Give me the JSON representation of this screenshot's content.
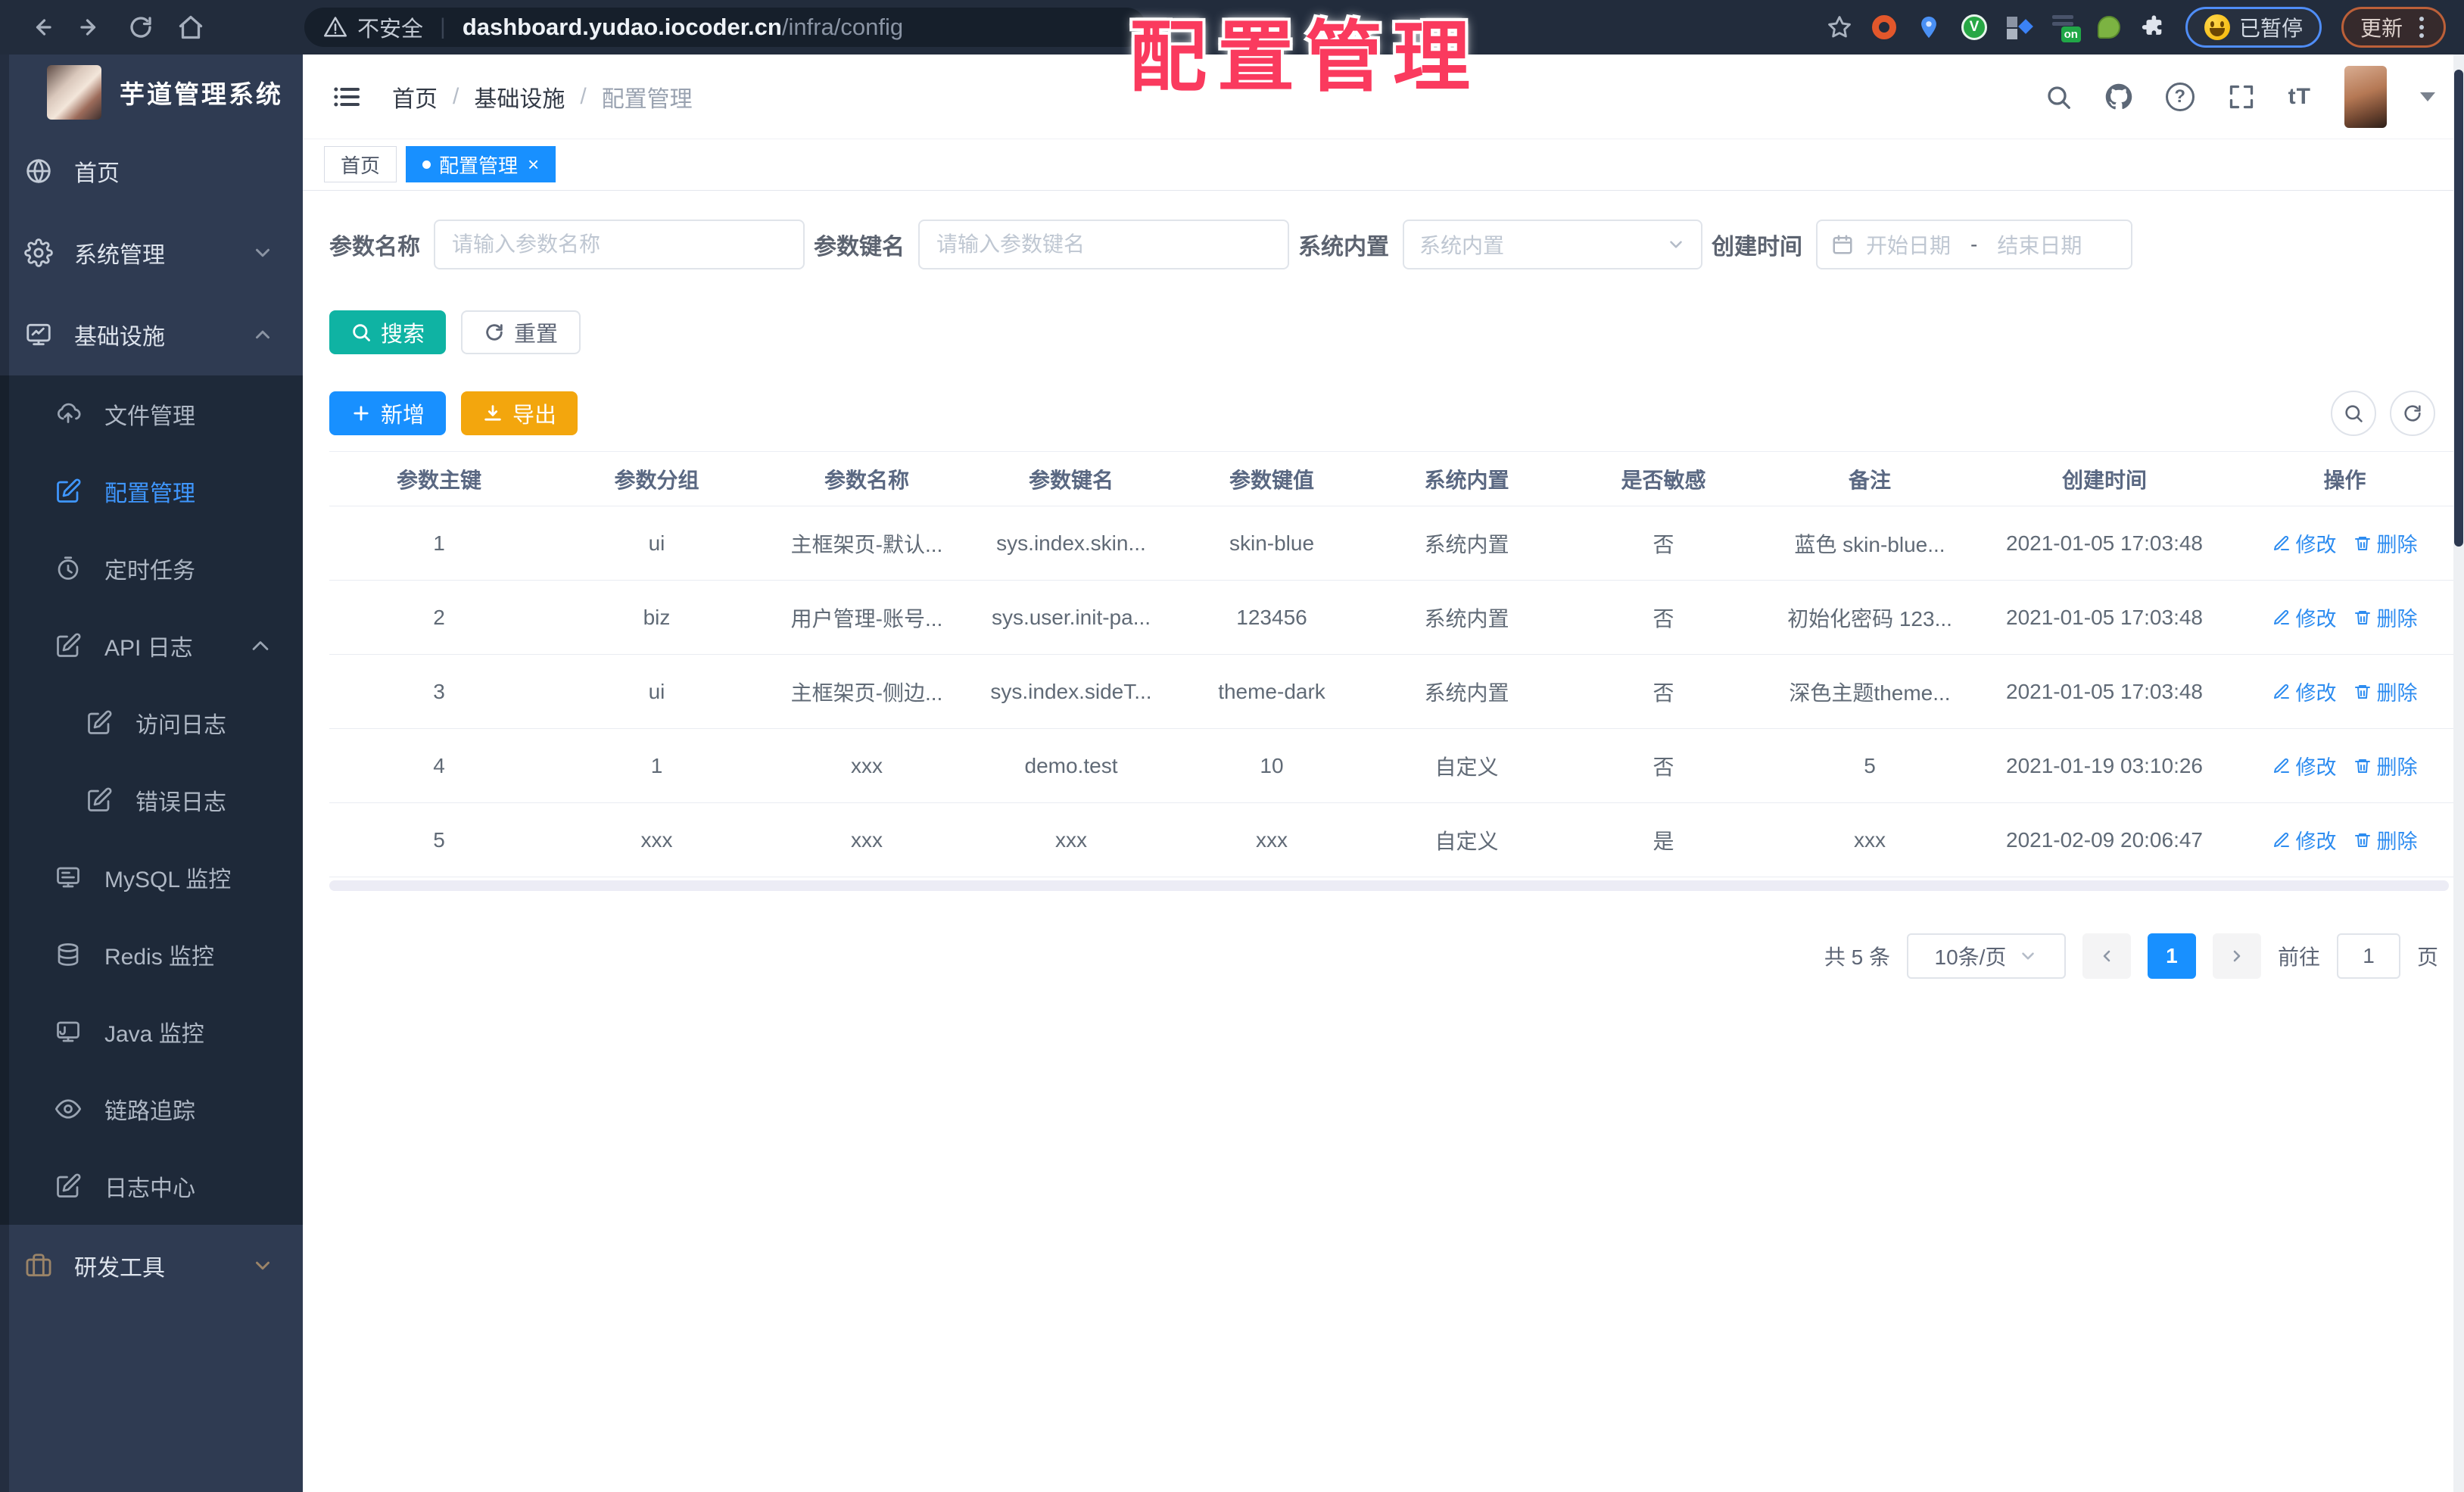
{
  "colors": {
    "accent_blue": "#1890ff",
    "search_teal": "#0fb3a3",
    "export_amber": "#f3a60d",
    "link_blue": "#2d8cf0",
    "sidebar_bg": "#2f3b52",
    "submenu_bg": "#1e2939",
    "browser_bar_bg": "#222c3c",
    "overlay_pink": "#fa3a5e"
  },
  "glyphs": {
    "separator": "/",
    "pipe": "|",
    "close": "×",
    "question": "?",
    "font_size": "tT",
    "ext_v": "V",
    "ext_on": "on"
  },
  "overlay_title": "配置管理",
  "browser": {
    "insecure_label": "不安全",
    "url_host": "dashboard.yudao.iocoder.cn",
    "url_path": "/infra/config",
    "paused_badge": "已暂停",
    "update_badge": "更新"
  },
  "sidebar": {
    "app_title": "芋道管理系统",
    "home": "首页",
    "system": "系统管理",
    "infra": "基础设施",
    "infra_children": {
      "file": "文件管理",
      "config": "配置管理",
      "job": "定时任务",
      "api_log": "API 日志",
      "access_log": "访问日志",
      "error_log": "错误日志",
      "mysql": "MySQL 监控",
      "redis": "Redis 监控",
      "java": "Java 监控",
      "trace": "链路追踪",
      "log_center": "日志中心"
    },
    "dev_tools": "研发工具"
  },
  "header": {
    "breadcrumb": [
      "首页",
      "基础设施",
      "配置管理"
    ]
  },
  "tabs": {
    "home": "首页",
    "active": "配置管理"
  },
  "filters": {
    "name_label": "参数名称",
    "name_placeholder": "请输入参数名称",
    "key_label": "参数键名",
    "key_placeholder": "请输入参数键名",
    "builtin_label": "系统内置",
    "builtin_placeholder": "系统内置",
    "date_label": "创建时间",
    "date_start_placeholder": "开始日期",
    "date_separator": "-",
    "date_end_placeholder": "结束日期"
  },
  "buttons": {
    "search": "搜索",
    "reset": "重置",
    "add": "新增",
    "export": "导出"
  },
  "table": {
    "headers": [
      "参数主键",
      "参数分组",
      "参数名称",
      "参数键名",
      "参数键值",
      "系统内置",
      "是否敏感",
      "备注",
      "创建时间",
      "操作"
    ],
    "action_edit": "修改",
    "action_delete": "删除",
    "rows": [
      {
        "id": "1",
        "group": "ui",
        "name": "主框架页-默认...",
        "key": "sys.index.skin...",
        "value": "skin-blue",
        "type": "系统内置",
        "sensitive": "否",
        "remark": "蓝色 skin-blue...",
        "created": "2021-01-05 17:03:48"
      },
      {
        "id": "2",
        "group": "biz",
        "name": "用户管理-账号...",
        "key": "sys.user.init-pa...",
        "value": "123456",
        "type": "系统内置",
        "sensitive": "否",
        "remark": "初始化密码 123...",
        "created": "2021-01-05 17:03:48"
      },
      {
        "id": "3",
        "group": "ui",
        "name": "主框架页-侧边...",
        "key": "sys.index.sideT...",
        "value": "theme-dark",
        "type": "系统内置",
        "sensitive": "否",
        "remark": "深色主题theme...",
        "created": "2021-01-05 17:03:48"
      },
      {
        "id": "4",
        "group": "1",
        "name": "xxx",
        "key": "demo.test",
        "value": "10",
        "type": "自定义",
        "sensitive": "否",
        "remark": "5",
        "created": "2021-01-19 03:10:26"
      },
      {
        "id": "5",
        "group": "xxx",
        "name": "xxx",
        "key": "xxx",
        "value": "xxx",
        "type": "自定义",
        "sensitive": "是",
        "remark": "xxx",
        "created": "2021-02-09 20:06:47"
      }
    ]
  },
  "pagination": {
    "total": "共 5 条",
    "page_size": "10条/页",
    "current_page": "1",
    "goto_label": "前往",
    "goto_value": "1",
    "page_unit": "页"
  }
}
